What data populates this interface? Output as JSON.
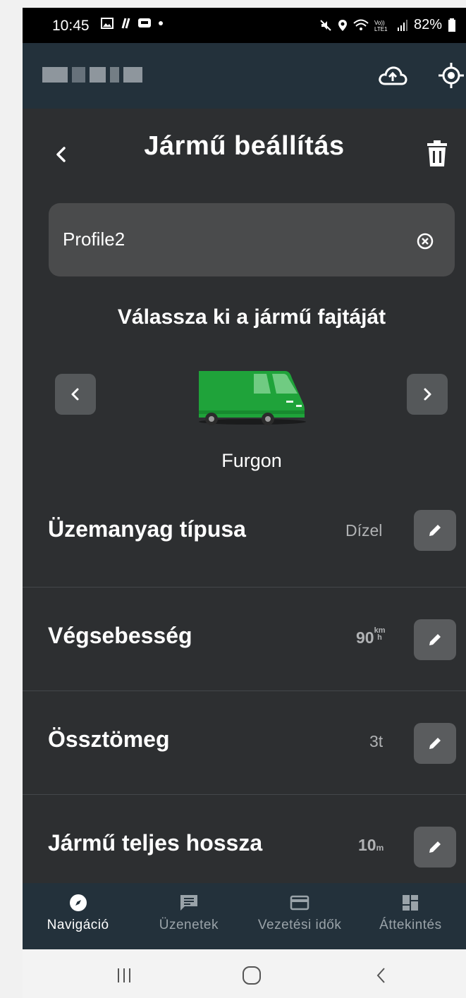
{
  "status_bar": {
    "time": "10:45",
    "battery": "82%",
    "icons_left": [
      "gallery-icon",
      "signal-slash-icon",
      "app-icon",
      "dot-icon"
    ],
    "icons_right": [
      "mute-icon",
      "location-icon",
      "wifi-icon",
      "volte-icon",
      "signal-icon",
      "battery-icon"
    ]
  },
  "app_bar": {
    "logo": "blurred-logo",
    "actions": [
      "cloud-upload-icon",
      "gps-target-icon"
    ]
  },
  "header": {
    "title": "Jármű beállítás",
    "back_icon": "chevron-left-icon",
    "delete_icon": "trash-icon"
  },
  "profile_name": {
    "value": "Profile2",
    "clear_icon": "clear-circle-icon"
  },
  "vehicle_picker": {
    "title": "Válassza ki a jármű fajtáját",
    "selected": "Furgon",
    "prev_icon": "chevron-left-icon",
    "next_icon": "chevron-right-icon",
    "vehicle_color": "#1fa33a"
  },
  "settings": [
    {
      "label": "Üzemanyag típusa",
      "value": "Dízel",
      "unit": ""
    },
    {
      "label": "Végsebesség",
      "value": "90",
      "unit_top": "km",
      "unit_bottom": "h"
    },
    {
      "label": "Össztömeg",
      "value": "3t",
      "unit": ""
    },
    {
      "label": "Jármű teljes hossza",
      "value": "10",
      "unit": "m"
    }
  ],
  "bottom_nav": [
    {
      "label": "Navigáció",
      "icon": "compass-icon",
      "active": true
    },
    {
      "label": "Üzenetek",
      "icon": "message-icon",
      "active": false
    },
    {
      "label": "Vezetési idők",
      "icon": "card-icon",
      "active": false
    },
    {
      "label": "Áttekintés",
      "icon": "dashboard-icon",
      "active": false
    }
  ],
  "colors": {
    "background": "#2d2f31",
    "app_bar": "#23313b",
    "field": "#4a4b4c",
    "button": "#5a5c5e"
  }
}
